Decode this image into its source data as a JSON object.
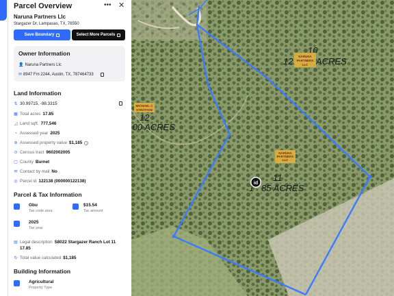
{
  "panel": {
    "title": "Parcel Overview",
    "more_icon": "ellipsis-icon",
    "close_icon": "close-icon",
    "owner_name": "Naruna Partners Llc",
    "address": "Stargazer Dr, Lampasas, TX, 76550",
    "save_button": "Save Boundary",
    "more_parcels_button": "Select More Parcels"
  },
  "owner_info": {
    "heading": "Owner Information",
    "name": "Naruna Partners Llc",
    "mailing_address": "8947 Fm 2244, Austin, TX, 787464733"
  },
  "land_info": {
    "heading": "Land Information",
    "coordinates": "30.99715, -98.3315",
    "total_acres_label": "Total acres",
    "total_acres": "17.85",
    "land_sqft_label": "Land sqft.",
    "land_sqft": "777,546",
    "assessed_year_label": "Assessed year",
    "assessed_year": "2025",
    "assessed_value_label": "Assessed property value",
    "assessed_value": "$1,185",
    "census_label": "Census tract",
    "census": "9602002005",
    "county_label": "County",
    "county": "Burnet",
    "contact_label": "Contact by mail",
    "contact": "No",
    "parcel_id_label": "Parcel id",
    "parcel_id": "122138 (000000122138)"
  },
  "tax_info": {
    "heading": "Parcel & Tax Information",
    "tax_code": "Gbu",
    "tax_code_label": "Tax code area",
    "tax_amount": "$15.54",
    "tax_amount_label": "Tax amount",
    "tax_year": "2025",
    "tax_year_label": "Tax year",
    "legal_label": "Legal description",
    "legal": "S8022 Stargazer Ranch Lot 11",
    "legal_cont": "17.85",
    "total_calc_label": "Total value calculated",
    "total_calc": "$1,185"
  },
  "building_info": {
    "heading": "Building Information",
    "property_type": "Agricultural",
    "property_type_label": "Property Type"
  },
  "map": {
    "lot_10_number": "10",
    "lot_10_acres": "12.",
    "lot_10_acres_suffix": "ACRES",
    "lot_12_number": "12",
    "lot_12_acres": ".00 ACRES",
    "lot_11_number": "11",
    "lot_11_acres": "1",
    "lot_11_acres_suffix": "85  ACRES",
    "owner_tag_1": "NARUNA",
    "owner_tag_2": "PARTNERS",
    "owner_tag_3": "LLC",
    "neighbor_tag_1": "MICHAEL C",
    "neighbor_tag_2": "STRATTON",
    "marker_label": "id",
    "colors": {
      "boundary": "#3a7bff",
      "aerial": "#7f8f62",
      "label_bg": "#e0b23c"
    }
  }
}
